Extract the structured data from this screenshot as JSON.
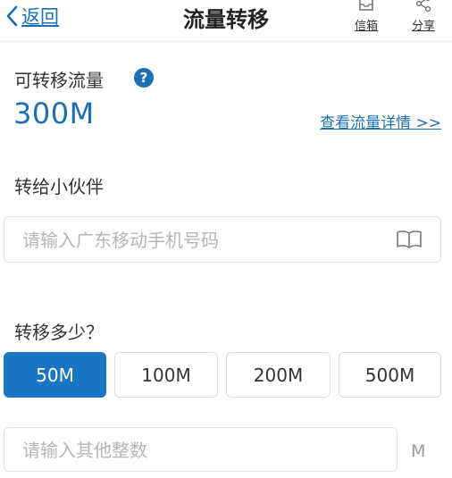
{
  "header": {
    "back_label": "返回",
    "title": "流量转移",
    "inbox_label": "信箱",
    "share_label": "分享"
  },
  "flow": {
    "transferable_label": "可转移流量",
    "help_symbol": "?",
    "amount": "300M",
    "detail_link": "查看流量详情 >>"
  },
  "recipient": {
    "section_label": "转给小伙伴",
    "phone_placeholder": "请输入广东移动手机号码"
  },
  "transfer": {
    "section_label": "转移多少？",
    "options": [
      {
        "label": "50M",
        "selected": true
      },
      {
        "label": "100M",
        "selected": false
      },
      {
        "label": "200M",
        "selected": false
      },
      {
        "label": "500M",
        "selected": false
      }
    ],
    "other_placeholder": "请输入其他整数",
    "unit": "M"
  },
  "colors": {
    "accent": "#1a6fb5",
    "selected_button": "#1a76c2",
    "placeholder": "#b5b5b5"
  },
  "icons": [
    "back-chevron-icon",
    "inbox-icon",
    "share-icon",
    "help-icon",
    "contacts-book-icon"
  ]
}
